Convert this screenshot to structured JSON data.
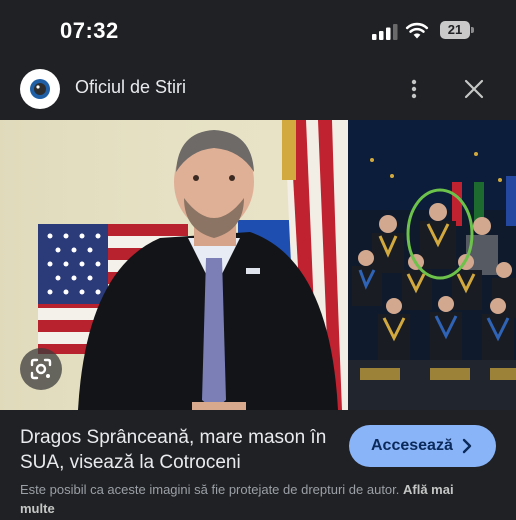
{
  "status_bar": {
    "time": "07:32",
    "battery_level": "21"
  },
  "source": {
    "name": "Oficiul de Stiri"
  },
  "icons": {
    "logo": "eye-logo-icon",
    "more": "more-vert-icon",
    "close": "close-icon",
    "lens": "google-lens-icon",
    "visit": "chevron-right-icon"
  },
  "article": {
    "headline": "Dragos Sprânceană, mare mason în SUA, visează la Cotroceni",
    "visit_label": "Accesează",
    "copyright_notice": "Este posibil ca aceste imagini să fie protejate de drepturi de autor.",
    "learn_more_label": "Află mai multe"
  },
  "colors": {
    "background": "#202124",
    "accent_button": "#8ab4f8",
    "accent_button_text": "#0b2a5b",
    "text_primary": "#e8eaed",
    "text_secondary": "#9aa0a6",
    "circle_highlight": "#6cc24a"
  }
}
